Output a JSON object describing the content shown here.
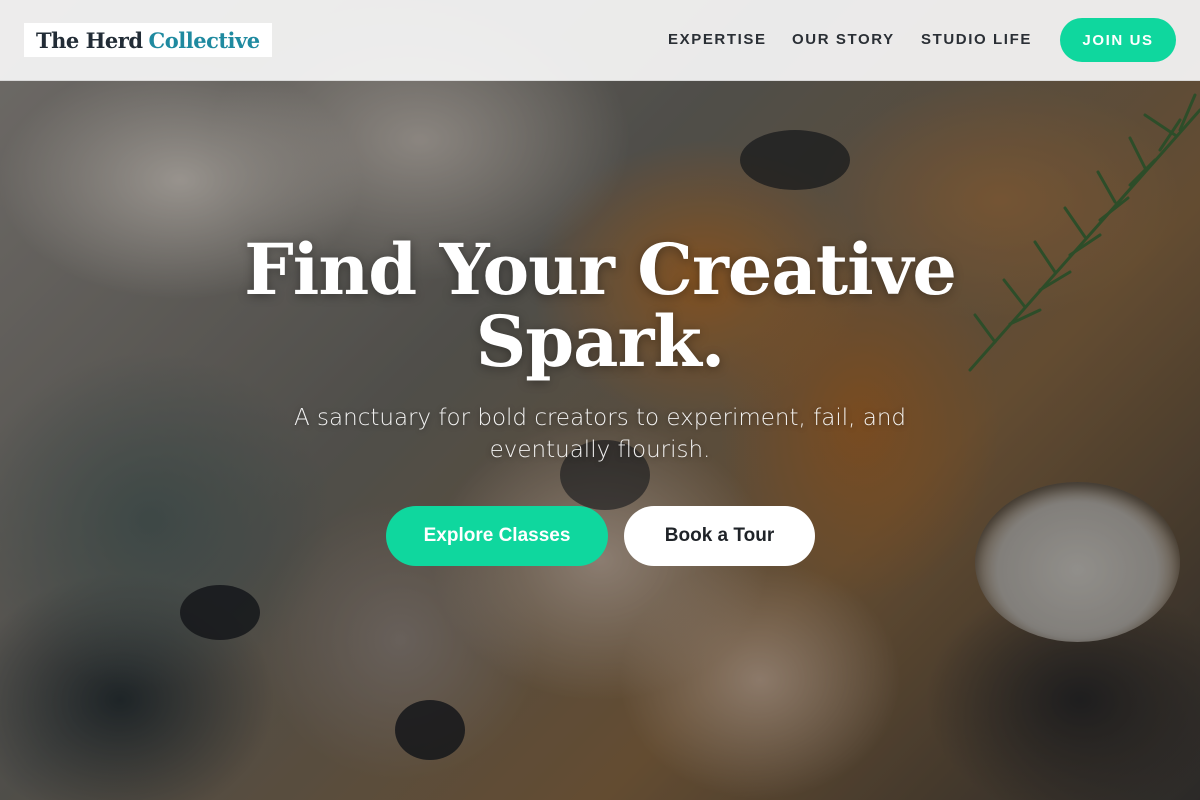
{
  "brand": {
    "name_part1": "The Herd",
    "name_part2": "Collective",
    "accent_color": "#0fd79e",
    "logo_accent_color": "#1f8aa0"
  },
  "nav": {
    "items": [
      {
        "label": "EXPERTISE"
      },
      {
        "label": "OUR STORY"
      },
      {
        "label": "STUDIO LIFE"
      }
    ],
    "cta_label": "JOIN US"
  },
  "hero": {
    "title_line1": "Find Your Creative",
    "title_line2": "Spark.",
    "subtitle": "A sanctuary for bold creators to experiment, fail, and eventually flourish.",
    "primary_button": "Explore Classes",
    "secondary_button": "Book a Tour",
    "background": "paint-palette-image"
  }
}
